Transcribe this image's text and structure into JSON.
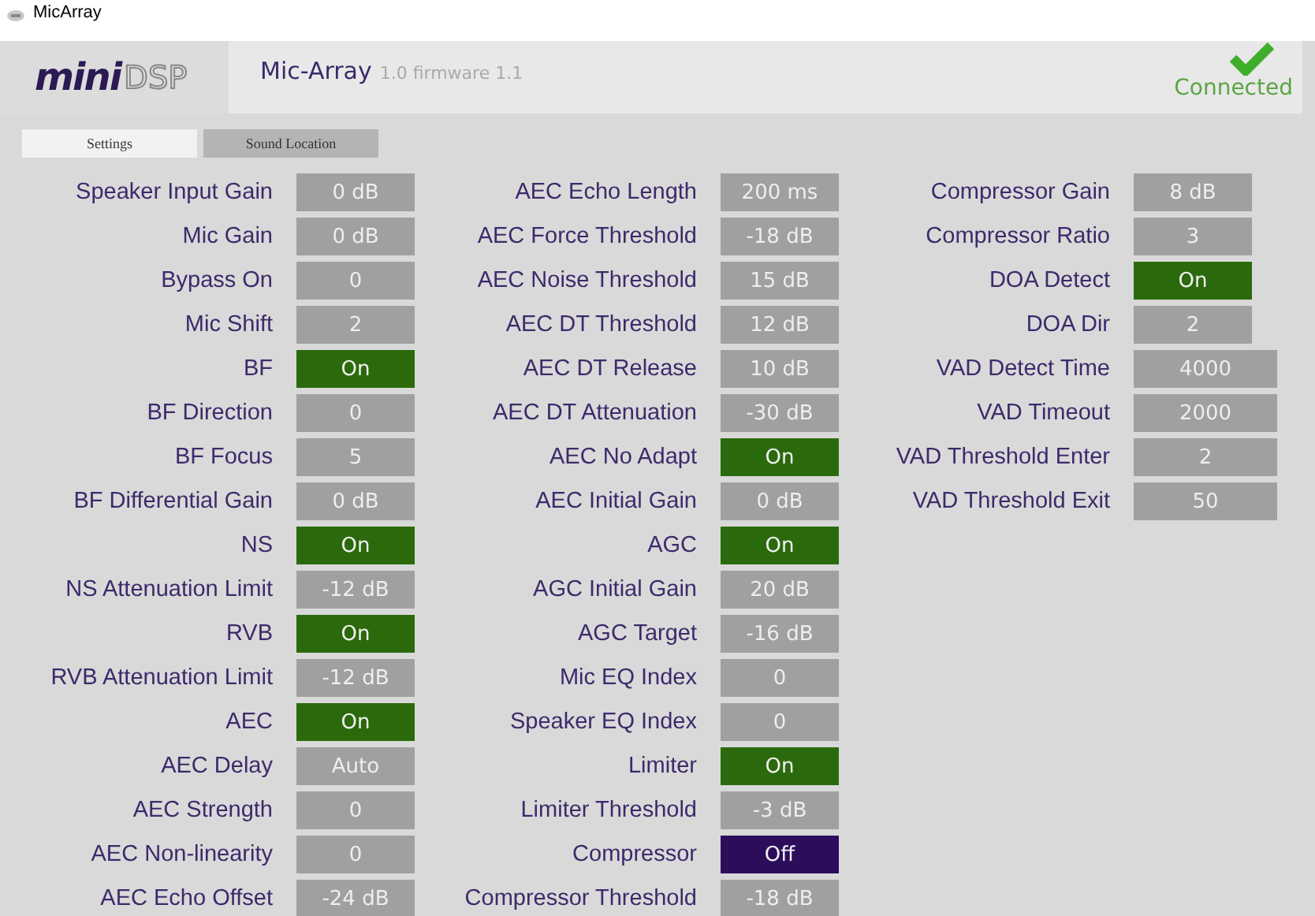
{
  "window": {
    "title": "MicArray"
  },
  "header": {
    "logo_main": "mini",
    "logo_sub": "DSP",
    "product": "Mic-Array",
    "version": "1.0 firmware 1.1",
    "status": "Connected",
    "connected": true
  },
  "tabs": [
    {
      "label": "Settings",
      "selected": true
    },
    {
      "label": "Sound Location",
      "selected": false
    }
  ],
  "columns": [
    [
      {
        "label": "Speaker Input Gain",
        "kind": "value",
        "value": "0 dB"
      },
      {
        "label": "Mic Gain",
        "kind": "value",
        "value": "0 dB"
      },
      {
        "label": "Bypass On",
        "kind": "value",
        "value": "0"
      },
      {
        "label": "Mic Shift",
        "kind": "value",
        "value": "2"
      },
      {
        "label": "BF",
        "kind": "toggle",
        "on": true,
        "value": "On"
      },
      {
        "label": "BF Direction",
        "kind": "value",
        "value": "0"
      },
      {
        "label": "BF Focus",
        "kind": "value",
        "value": "5"
      },
      {
        "label": "BF Differential Gain",
        "kind": "value",
        "value": "0 dB"
      },
      {
        "label": "NS",
        "kind": "toggle",
        "on": true,
        "value": "On"
      },
      {
        "label": "NS Attenuation Limit",
        "kind": "value",
        "value": "-12 dB"
      },
      {
        "label": "RVB",
        "kind": "toggle",
        "on": true,
        "value": "On"
      },
      {
        "label": "RVB Attenuation Limit",
        "kind": "value",
        "value": "-12 dB"
      },
      {
        "label": "AEC",
        "kind": "toggle",
        "on": true,
        "value": "On"
      },
      {
        "label": "AEC Delay",
        "kind": "value",
        "value": "Auto"
      },
      {
        "label": "AEC Strength",
        "kind": "value",
        "value": "0"
      },
      {
        "label": "AEC Non-linearity",
        "kind": "value",
        "value": "0"
      },
      {
        "label": "AEC Echo Offset",
        "kind": "value",
        "value": "-24 dB"
      }
    ],
    [
      {
        "label": "AEC Echo Length",
        "kind": "value",
        "value": "200 ms"
      },
      {
        "label": "AEC Force Threshold",
        "kind": "value",
        "value": "-18 dB"
      },
      {
        "label": "AEC Noise Threshold",
        "kind": "value",
        "value": "15 dB"
      },
      {
        "label": "AEC DT Threshold",
        "kind": "value",
        "value": "12 dB"
      },
      {
        "label": "AEC DT Release",
        "kind": "value",
        "value": "10 dB"
      },
      {
        "label": "AEC DT Attenuation",
        "kind": "value",
        "value": "-30 dB"
      },
      {
        "label": "AEC No Adapt",
        "kind": "toggle",
        "on": true,
        "value": "On"
      },
      {
        "label": "AEC Initial Gain",
        "kind": "value",
        "value": "0 dB"
      },
      {
        "label": "AGC",
        "kind": "toggle",
        "on": true,
        "value": "On"
      },
      {
        "label": "AGC Initial Gain",
        "kind": "value",
        "value": "20 dB"
      },
      {
        "label": "AGC Target",
        "kind": "value",
        "value": "-16 dB"
      },
      {
        "label": "Mic EQ Index",
        "kind": "value",
        "value": "0"
      },
      {
        "label": "Speaker EQ Index",
        "kind": "value",
        "value": "0"
      },
      {
        "label": "Limiter",
        "kind": "toggle",
        "on": true,
        "value": "On"
      },
      {
        "label": "Limiter Threshold",
        "kind": "value",
        "value": "-3 dB"
      },
      {
        "label": "Compressor",
        "kind": "toggle",
        "on": false,
        "value": "Off"
      },
      {
        "label": "Compressor Threshold",
        "kind": "value",
        "value": "-18 dB"
      }
    ],
    [
      {
        "label": "Compressor Gain",
        "kind": "value",
        "value": "8 dB"
      },
      {
        "label": "Compressor Ratio",
        "kind": "value",
        "value": "3"
      },
      {
        "label": "DOA Detect",
        "kind": "toggle",
        "on": true,
        "value": "On"
      },
      {
        "label": "DOA Dir",
        "kind": "value",
        "value": "2"
      },
      {
        "label": "VAD Detect Time",
        "kind": "wide",
        "value": "4000"
      },
      {
        "label": "VAD Timeout",
        "kind": "wide",
        "value": "2000"
      },
      {
        "label": "VAD Threshold Enter",
        "kind": "wide",
        "value": "2"
      },
      {
        "label": "VAD Threshold Exit",
        "kind": "wide",
        "value": "50"
      }
    ]
  ]
}
